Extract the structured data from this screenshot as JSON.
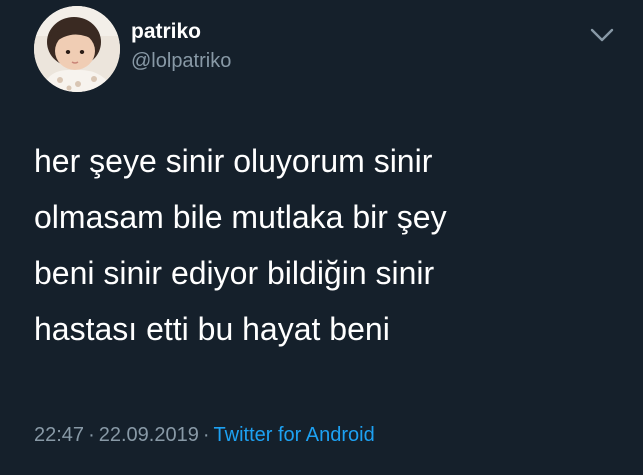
{
  "tweet": {
    "author": {
      "display_name": "patriko",
      "handle": "@lolpatriko",
      "avatar": "avatar-photo-child"
    },
    "menu_icon": "chevron-down-icon",
    "text": "her şeye sinir oluyorum sinir\nolmasam bile mutlaka bir şey\nbeni sinir ediyor bildiğin sinir\nhastası etti bu hayat beni",
    "time": "22:47",
    "separator": "·",
    "date": "22.09.2019",
    "source": "Twitter for Android"
  },
  "colors": {
    "background": "#15202b",
    "text_primary": "#ffffff",
    "text_secondary": "#8899a6",
    "link": "#1da1f2"
  }
}
